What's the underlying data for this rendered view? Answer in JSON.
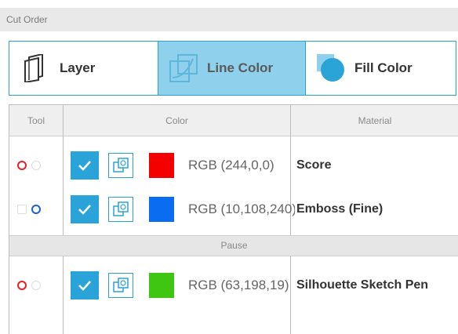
{
  "panel": {
    "title": "Cut Order"
  },
  "modes": {
    "layer_label": "Layer",
    "line_color_label": "Line Color",
    "fill_color_label": "Fill Color",
    "selected": "Line Color"
  },
  "table": {
    "columns": [
      "Tool",
      "Color",
      "Material"
    ],
    "rows": [
      {
        "tool": "1",
        "checked": true,
        "color_hex": "#f40000",
        "rgb_text": "RGB (244,0,0)",
        "material": "Score"
      },
      {
        "tool": "2",
        "checked": true,
        "color_hex": "#0a6cf0",
        "rgb_text": "RGB (10,108,240)",
        "material": "Emboss (Fine)"
      },
      {
        "tool": "1",
        "checked": true,
        "color_hex": "#3fc613",
        "rgb_text": "RGB (63,198,19)",
        "material": "Silhouette Sketch Pen"
      }
    ],
    "pause_label": "Pause"
  },
  "colors": {
    "accent": "#2aa3d6",
    "checkbox": "#29a3d8",
    "selected_mode_bg": "#8fd0ec",
    "tool_active_red": "#e8202a",
    "tool_active_blue": "#1a5fd6"
  }
}
